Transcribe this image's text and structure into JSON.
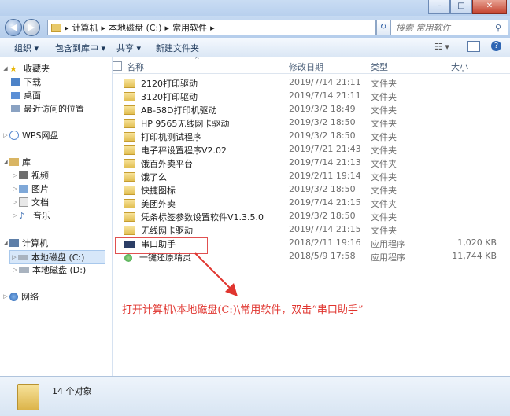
{
  "address": {
    "path": [
      "计算机",
      "本地磁盘 (C:)",
      "常用软件"
    ]
  },
  "search": {
    "placeholder": "搜索 常用软件"
  },
  "toolbar": {
    "organize": "组织 ▾",
    "include_library": "包含到库中 ▾",
    "share": "共享 ▾",
    "new_folder": "新建文件夹"
  },
  "sidebar": {
    "favorites": "收藏夹",
    "downloads": "下载",
    "desktop": "桌面",
    "recent": "最近访问的位置",
    "wps": "WPS网盘",
    "library": "库",
    "videos": "视频",
    "pictures": "图片",
    "documents": "文档",
    "music": "音乐",
    "computer": "计算机",
    "drive_c": "本地磁盘 (C:)",
    "drive_d": "本地磁盘 (D:)",
    "network": "网络"
  },
  "columns": {
    "name": "名称",
    "date": "修改日期",
    "type": "类型",
    "size": "大小"
  },
  "files": [
    {
      "name": "2120打印驱动",
      "date": "2019/7/14 21:11",
      "type": "文件夹",
      "size": ""
    },
    {
      "name": "3120打印驱动",
      "date": "2019/7/14 21:11",
      "type": "文件夹",
      "size": ""
    },
    {
      "name": "AB-58D打印机驱动",
      "date": "2019/3/2 18:49",
      "type": "文件夹",
      "size": ""
    },
    {
      "name": "HP 9565无线网卡驱动",
      "date": "2019/3/2 18:50",
      "type": "文件夹",
      "size": ""
    },
    {
      "name": "打印机测试程序",
      "date": "2019/3/2 18:50",
      "type": "文件夹",
      "size": ""
    },
    {
      "name": "电子秤设置程序V2.02",
      "date": "2019/7/21 21:43",
      "type": "文件夹",
      "size": ""
    },
    {
      "name": "饿百外卖平台",
      "date": "2019/7/14 21:13",
      "type": "文件夹",
      "size": ""
    },
    {
      "name": "饿了么",
      "date": "2019/2/11 19:14",
      "type": "文件夹",
      "size": ""
    },
    {
      "name": "快捷图标",
      "date": "2019/3/2 18:50",
      "type": "文件夹",
      "size": ""
    },
    {
      "name": "美团外卖",
      "date": "2019/7/14 21:15",
      "type": "文件夹",
      "size": ""
    },
    {
      "name": "凭条标签参数设置软件V1.3.5.0",
      "date": "2019/3/2 18:50",
      "type": "文件夹",
      "size": ""
    },
    {
      "name": "无线网卡驱动",
      "date": "2019/7/14 21:15",
      "type": "文件夹",
      "size": ""
    },
    {
      "name": "串口助手",
      "date": "2018/2/11 19:16",
      "type": "应用程序",
      "size": "1,020 KB"
    },
    {
      "name": "一键还原精灵",
      "date": "2018/5/9 17:58",
      "type": "应用程序",
      "size": "11,744 KB"
    }
  ],
  "status": {
    "count": "14 个对象"
  },
  "annotation": {
    "text": "打开计算机\\本地磁盘(C:)\\常用软件，双击“串口助手”",
    "color": "#e0352f"
  }
}
